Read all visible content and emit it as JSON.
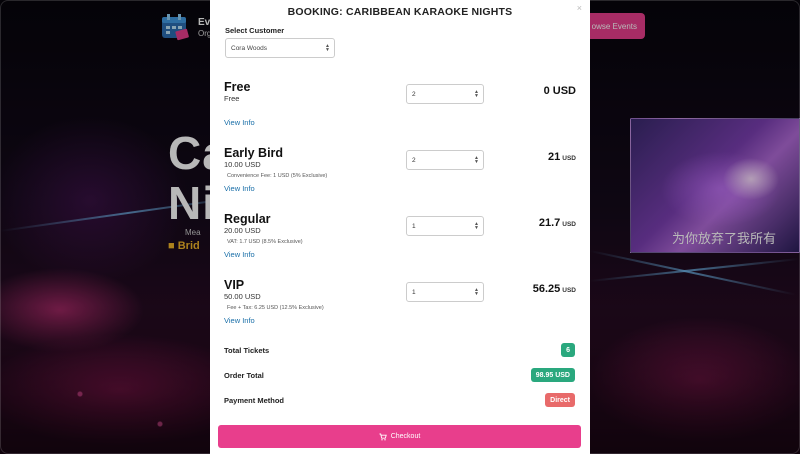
{
  "background": {
    "brand": "Ev",
    "brand_sub": "Org",
    "browse_button": "owse Events",
    "hero_title_line1": "Ca",
    "hero_title_line2": "Ni",
    "hero_subtext": "Mea",
    "hero_venue": "Brid",
    "stage_caption": "为你放弃了我所有"
  },
  "modal": {
    "title": "BOOKING: CARIBBEAN KARAOKE NIGHTS",
    "close_label": "×",
    "customer": {
      "label": "Select Customer",
      "selected": "Cora Woods"
    },
    "tickets": [
      {
        "name": "Free",
        "price": "Free",
        "fee_note": "",
        "quantity": "2",
        "total": "0 USD",
        "total_currency": "",
        "info_link": "View Info"
      },
      {
        "name": "Early Bird",
        "price": "10.00 USD",
        "fee_note": "Convenience Fee: 1 USD (5% Exclusive)",
        "quantity": "2",
        "total": "21",
        "total_currency": "USD",
        "info_link": "View Info"
      },
      {
        "name": "Regular",
        "price": "20.00 USD",
        "fee_note": "VAT: 1.7 USD (8.5% Exclusive)",
        "quantity": "1",
        "total": "21.7",
        "total_currency": "USD",
        "info_link": "View Info"
      },
      {
        "name": "VIP",
        "price": "50.00 USD",
        "fee_note": "Fee + Tax: 6.25 USD (12.5% Exclusive)",
        "quantity": "1",
        "total": "56.25",
        "total_currency": "USD",
        "info_link": "View Info"
      }
    ],
    "summary": {
      "total_tickets_label": "Total Tickets",
      "total_tickets_value": "6",
      "order_total_label": "Order Total",
      "order_total_value": "98.95 USD",
      "payment_method_label": "Payment Method",
      "payment_method_value": "Direct"
    },
    "checkout_label": "Checkout",
    "colors": {
      "accent": "#e83e8c",
      "badge_green": "#2aa87e",
      "badge_red": "#e86a6a",
      "link": "#1a6fa8"
    }
  }
}
